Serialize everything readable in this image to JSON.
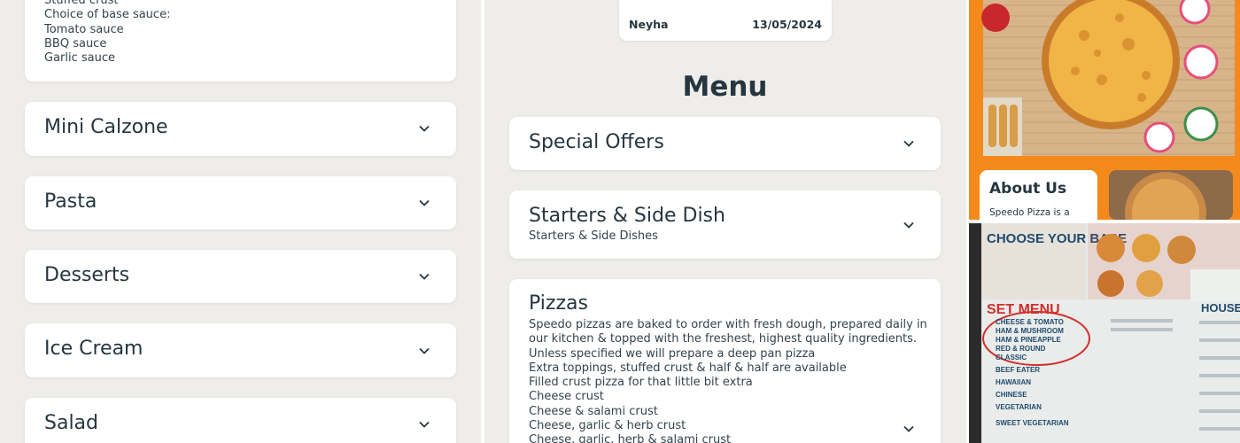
{
  "left_column": {
    "base_card_lines": [
      "Stuffed crust",
      "Choice of base sauce:",
      "Tomato sauce",
      "BBQ sauce",
      "Garlic sauce"
    ],
    "categories": [
      {
        "title": "Mini Calzone"
      },
      {
        "title": "Pasta"
      },
      {
        "title": "Desserts"
      },
      {
        "title": "Ice Cream"
      },
      {
        "title": "Salad"
      }
    ]
  },
  "middle_column": {
    "info": {
      "name": "Neyha",
      "date": "13/05/2024"
    },
    "menu_heading": "Menu",
    "special_offers": {
      "title": "Special Offers"
    },
    "starters": {
      "title": "Starters & Side Dish",
      "subtitle": "Starters & Side Dishes"
    },
    "pizzas": {
      "title": "Pizzas",
      "lines": [
        "Speedo pizzas are baked to order with fresh dough, prepared daily in",
        "our kitchen & topped with the freshest, highest quality ingredients.",
        "Unless specified we will prepare a deep pan pizza",
        "Extra toppings, stuffed crust & half & half are available",
        "Filled crust pizza for that little bit extra",
        "Cheese crust",
        "Cheese & salami crust",
        "Cheese, garlic & herb crust",
        "Cheese, garlic, herb & salami crust"
      ]
    }
  },
  "right_column": {
    "about": {
      "title": "About Us",
      "text": "Speedo Pizza is a"
    },
    "menu_photo": {
      "heading": "CHOOSE YOUR BASE",
      "set_menu": "SET MENU",
      "house": "HOUSE",
      "items": [
        "CHEESE & TOMATO",
        "HAM & MUSHROOM",
        "HAM & PINEAPPLE",
        "RED & ROUND",
        "CLASSIC",
        "BEEF EATER",
        "HAWAIIAN",
        "CHINESE",
        "VEGETARIAN",
        "SWEET VEGETARIAN"
      ]
    }
  },
  "colors": {
    "accent_orange": "#f58a1c",
    "text_dark": "#263640",
    "background": "#eeedea"
  }
}
